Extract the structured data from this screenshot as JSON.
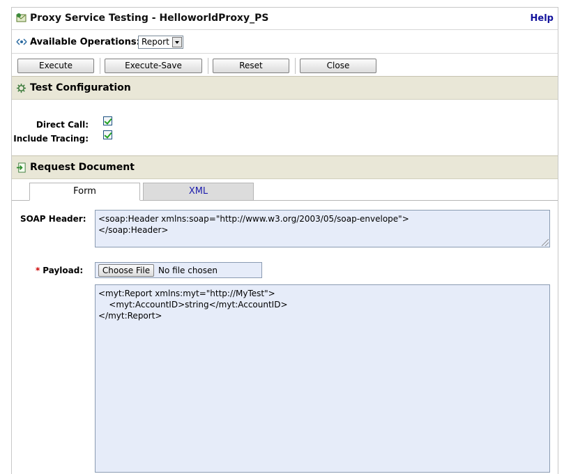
{
  "header": {
    "title": "Proxy Service Testing - HelloworldProxy_PS",
    "help_label": "Help"
  },
  "operations": {
    "label": "Available Operations:",
    "selected": "Report"
  },
  "toolbar": {
    "execute_label": "Execute",
    "execute_save_label": "Execute-Save",
    "reset_label": "Reset",
    "close_label": "Close"
  },
  "test_config": {
    "title": "Test Configuration",
    "direct_call_label": "Direct Call:",
    "direct_call_checked": true,
    "include_tracing_label": "Include Tracing:",
    "include_tracing_checked": true
  },
  "request": {
    "title": "Request Document",
    "tabs": [
      {
        "label": "Form",
        "active": true
      },
      {
        "label": "XML",
        "active": false
      }
    ],
    "soap_header_label": "SOAP Header:",
    "soap_header_value": "<soap:Header xmlns:soap=\"http://www.w3.org/2003/05/soap-envelope\">\n</soap:Header>",
    "payload_required_mark": "*",
    "payload_label": "Payload:",
    "choose_file_label": "Choose File",
    "file_status": "No file chosen",
    "payload_value": "<myt:Report xmlns:myt=\"http://MyTest\">\n    <myt:AccountID>string</myt:AccountID>\n</myt:Report>"
  },
  "colors": {
    "section_background": "#e9e7d7",
    "link": "#12129c",
    "textarea_background": "#e6ecf9",
    "required": "#cc0000"
  }
}
